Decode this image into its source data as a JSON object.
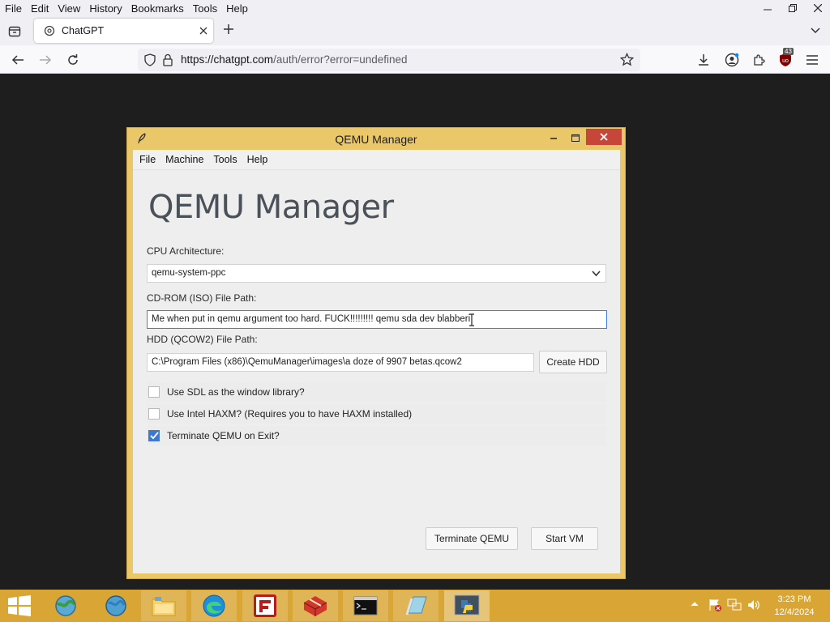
{
  "browser": {
    "menu": [
      "File",
      "Edit",
      "View",
      "History",
      "Bookmarks",
      "Tools",
      "Help"
    ],
    "tab_title": "ChatGPT",
    "url_host": "https://chatgpt.com",
    "url_path": "/auth/error?error=undefined",
    "ublock_count": "43"
  },
  "qemu_window": {
    "title": "QEMU Manager",
    "menu": [
      "File",
      "Machine",
      "Tools",
      "Help"
    ],
    "heading": "QEMU Manager",
    "cpu_label": "CPU Architecture:",
    "cpu_value": "qemu-system-ppc",
    "cdrom_label": "CD-ROM (ISO) File Path:",
    "cdrom_value": "Me when put in   qemu argument too hard.    FUCK!!!!!!!!! qemu sda dev blabberi",
    "hdd_label": "HDD (QCOW2) File Path:",
    "hdd_value": "C:\\Program Files (x86)\\QemuManager\\images\\a doze of 9907 betas.qcow2",
    "create_hdd": "Create HDD",
    "options": [
      {
        "label": "Use SDL as the window library?",
        "checked": false
      },
      {
        "label": "Use Intel HAXM? (Requires you to have HAXM installed)",
        "checked": false
      },
      {
        "label": "Terminate QEMU on Exit?",
        "checked": true
      }
    ],
    "terminate_button": "Terminate QEMU",
    "start_button": "Start VM"
  },
  "taskbar": {
    "time": "3:23 PM",
    "date": "12/4/2024"
  },
  "colors": {
    "taskbar": "#d9a534",
    "window_frame": "#eac86a",
    "close_button": "#c7463a",
    "checkbox_checked": "#3d79cf"
  }
}
